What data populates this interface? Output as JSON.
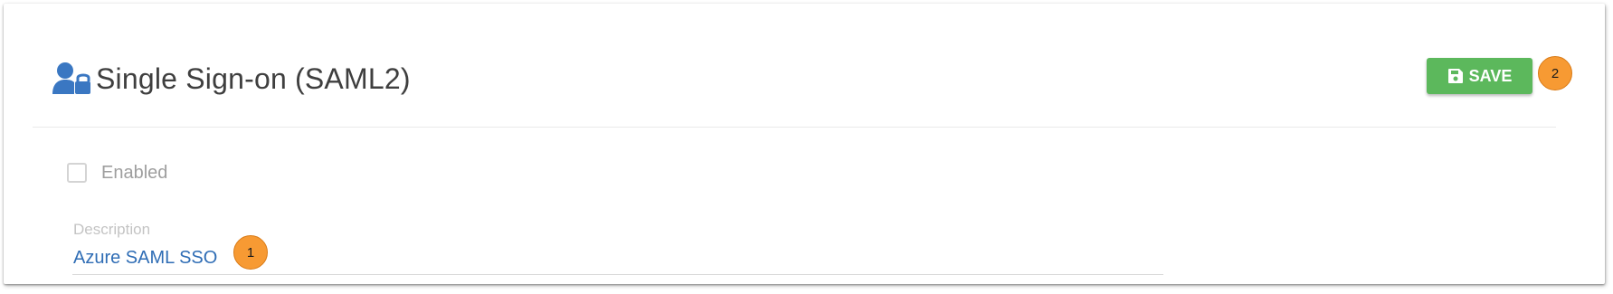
{
  "page": {
    "title": "Single Sign-on (SAML2)",
    "title_icon": "user-lock-icon"
  },
  "toolbar": {
    "save_label": "SAVE",
    "save_icon": "floppy-disk-icon",
    "save_color": "#5cb85c"
  },
  "form": {
    "enabled": {
      "label": "Enabled",
      "checked": false
    },
    "description": {
      "label": "Description",
      "value": "Azure SAML SSO"
    }
  },
  "annotations": {
    "badge_1": "1",
    "badge_2": "2",
    "color": "#f79a33"
  },
  "colors": {
    "accent": "#3a77c2",
    "input_text": "#2f6db5"
  }
}
